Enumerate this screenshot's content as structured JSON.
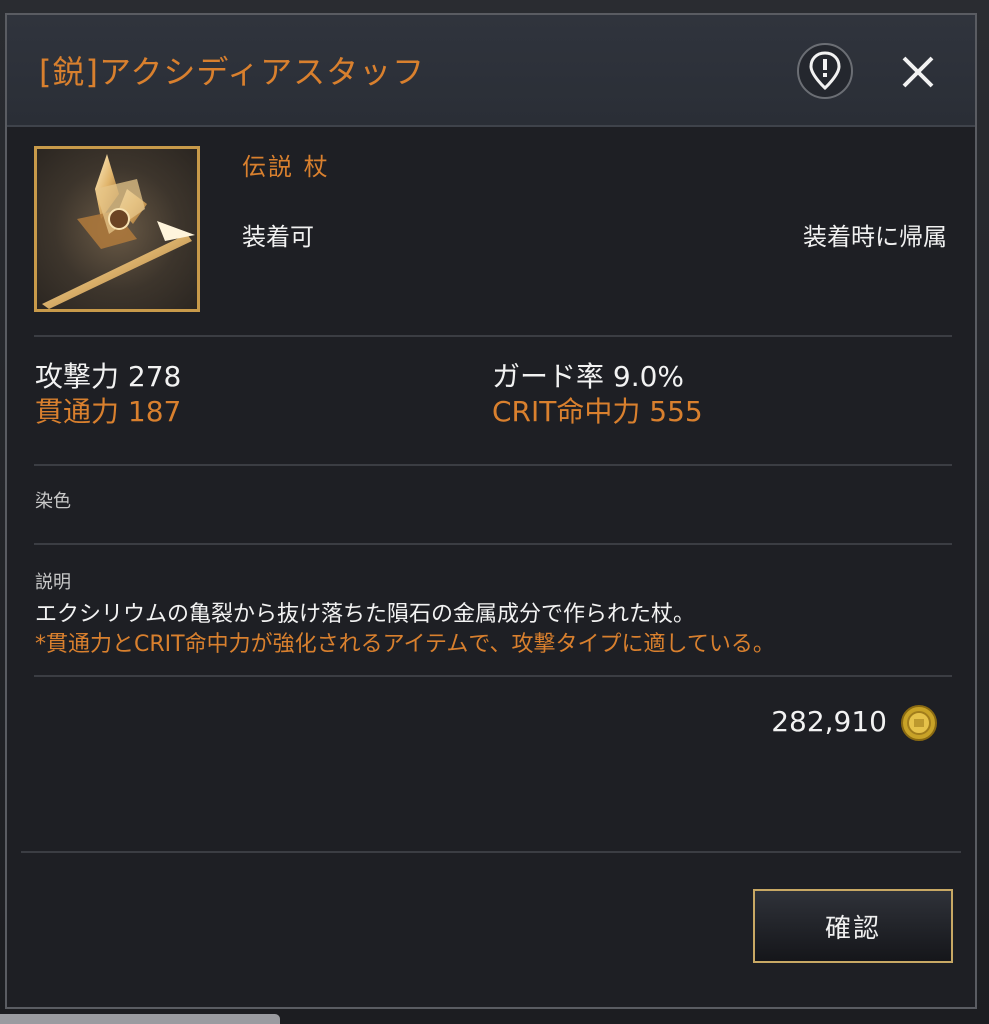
{
  "item": {
    "title": "[鋭]アクシディアスタッフ",
    "rarity_type": "伝説  杖",
    "equip_status": "装着可",
    "bind_status": "装着時に帰属",
    "thumbnail_icon": "staff-weapon-icon"
  },
  "stats": [
    {
      "label": "攻撃力 278",
      "color": "white"
    },
    {
      "label": "ガード率 9.0%",
      "color": "white"
    },
    {
      "label": "貫通力 187",
      "color": "orange"
    },
    {
      "label": "CRIT命中力 555",
      "color": "orange"
    }
  ],
  "dye": {
    "label": "染色"
  },
  "description": {
    "label": "説明",
    "line1": "エクシリウムの亀裂から抜け落ちた隕石の金属成分で作られた杖。",
    "line2": "*貫通力とCRIT命中力が強化されるアイテムで、攻撃タイプに適している。"
  },
  "price": {
    "value": "282,910",
    "currency_icon": "gold-coin-icon"
  },
  "buttons": {
    "confirm": "確認",
    "pin_icon": "map-pin-alert-icon",
    "close_icon": "close-icon"
  },
  "colors": {
    "accent_orange": "#d9802e",
    "button_border": "#c8a864",
    "thumbnail_border": "#c89a4a"
  }
}
